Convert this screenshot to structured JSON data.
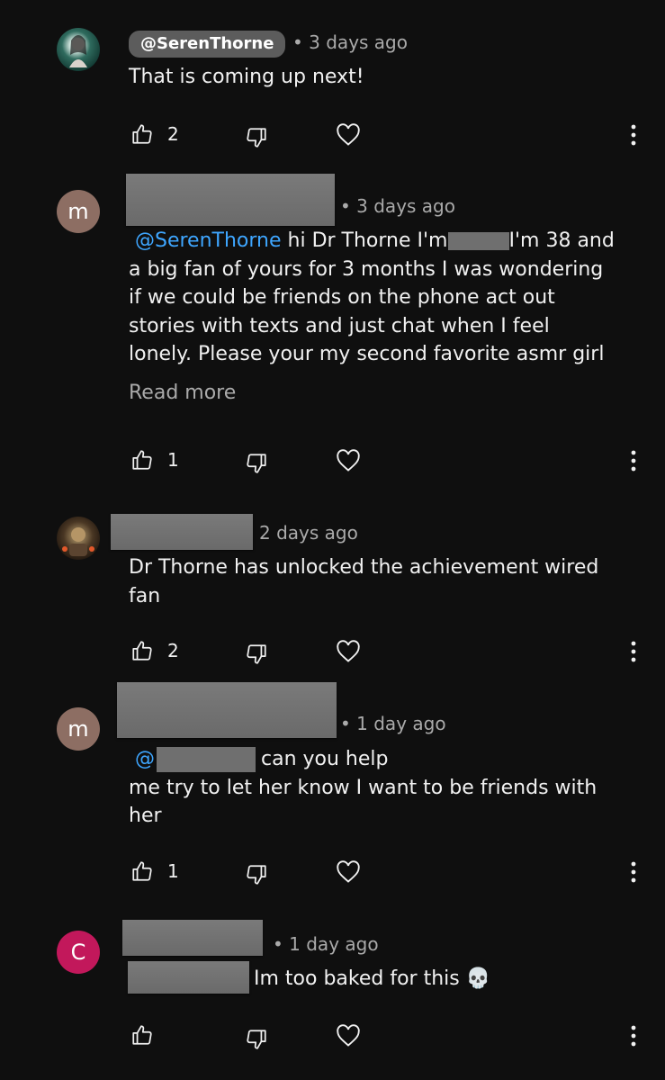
{
  "comments": [
    {
      "author_handle": "@SerenThorne",
      "time": "3 days ago",
      "text": "That is coming up next!",
      "likes": "2",
      "avatar_letter": "",
      "avatar_color": "#1b4d43"
    },
    {
      "author_handle": "",
      "avatar_letter": "m",
      "avatar_color": "#8d6e63",
      "time": "3 days ago",
      "mention": "@SerenThorne",
      "text_a": " hi Dr Thorne I'm",
      "text_b": "I'm 38 and",
      "text_lines": [
        "a big fan of yours for 3 months I was wondering",
        "if we could be friends on the phone act out",
        "stories with texts and just chat when I feel",
        "lonely. Please your my second favorite asmr girl"
      ],
      "read_more": "Read more",
      "likes": "1"
    },
    {
      "author_handle": "",
      "time": "2 days ago",
      "text_lines": [
        "Dr Thorne has unlocked the achievement wired",
        "fan"
      ],
      "likes": "2",
      "avatar_color": "#3a2a1e"
    },
    {
      "author_handle": "",
      "avatar_letter": "m",
      "avatar_color": "#8d6e63",
      "time": "1 day ago",
      "mention": "@",
      "text_a": "can you help",
      "text_lines": [
        "me try to let her know I want to be friends with",
        "her"
      ],
      "likes": "1"
    },
    {
      "author_handle": "",
      "avatar_letter": "C",
      "avatar_color": "#c2185b",
      "time": "1 day ago",
      "text": "Im too baked for this",
      "emoji": "💀",
      "likes": ""
    }
  ],
  "icons": {
    "like": "thumbs-up-icon",
    "dislike": "thumbs-down-icon",
    "heart": "heart-icon",
    "more": "more-vert-icon"
  }
}
